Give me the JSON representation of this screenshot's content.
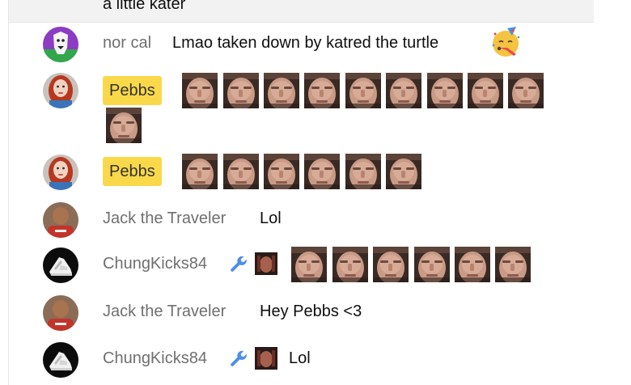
{
  "previous_message": {
    "text": "a little kater"
  },
  "colors": {
    "member_chip": "#f9d94a",
    "author": "#6f6f6f",
    "text": "#0f0f0f",
    "moderator_wrench": "#4e8ee8"
  },
  "messages": [
    {
      "author": "nor cal",
      "text": "Lmao taken down by katred the turtle",
      "trailing_icon": "party-face-emoji",
      "avatar": "white-figure-purple-background"
    },
    {
      "author": "Pebbs",
      "member_highlight": true,
      "emote_count": 10,
      "emote_name": "face-emote",
      "avatar": "red-hair-woman"
    },
    {
      "author": "Pebbs",
      "member_highlight": true,
      "emote_count": 6,
      "emote_name": "face-emote",
      "avatar": "red-hair-woman"
    },
    {
      "author": "Jack the Traveler",
      "text": "Lol",
      "avatar": "man-red-shirt"
    },
    {
      "author": "ChungKicks84",
      "badges": [
        "wrench-icon",
        "member-badge"
      ],
      "emote_count": 6,
      "emote_name": "face-emote",
      "avatar": "sneaker"
    },
    {
      "author": "Jack the Traveler",
      "text": "Hey Pebbs <3",
      "avatar": "man-red-shirt"
    },
    {
      "author": "ChungKicks84",
      "badges": [
        "wrench-icon",
        "member-badge"
      ],
      "text": "Lol",
      "avatar": "sneaker"
    }
  ]
}
